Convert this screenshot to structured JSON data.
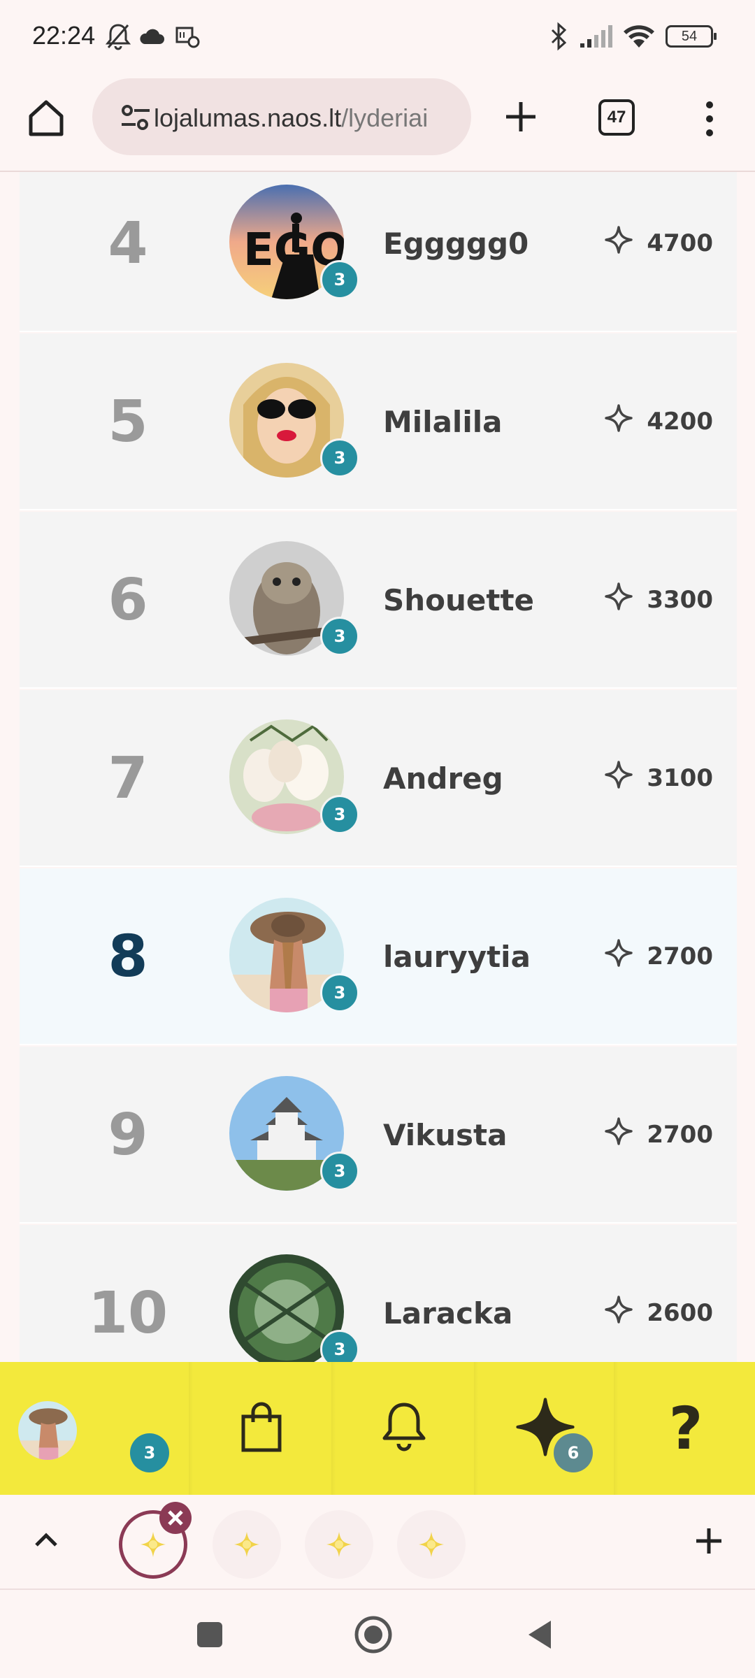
{
  "status_bar": {
    "time": "22:24",
    "battery": "54",
    "icons": [
      "bell-off-icon",
      "cloud-icon",
      "ticket-icon",
      "bluetooth-icon",
      "signal-icon",
      "wifi-icon",
      "battery-icon"
    ]
  },
  "browser": {
    "url_host": "lojalumas.naos.lt",
    "url_path": "/lyderiai",
    "tab_count": "47",
    "icons": [
      "home-icon",
      "site-settings-icon",
      "new-tab-plus-icon",
      "tab-switcher-icon",
      "more-menu-icon"
    ]
  },
  "leaderboard": {
    "rows": [
      {
        "rank": "4",
        "name": "Eggggg0",
        "level": "3",
        "points": "4700",
        "current_user": false
      },
      {
        "rank": "5",
        "name": "Milalila",
        "level": "3",
        "points": "4200",
        "current_user": false
      },
      {
        "rank": "6",
        "name": "Shouette",
        "level": "3",
        "points": "3300",
        "current_user": false
      },
      {
        "rank": "7",
        "name": "Andreg",
        "level": "3",
        "points": "3100",
        "current_user": false
      },
      {
        "rank": "8",
        "name": "lauryytia",
        "level": "3",
        "points": "2700",
        "current_user": true
      },
      {
        "rank": "9",
        "name": "Vikusta",
        "level": "3",
        "points": "2700",
        "current_user": false
      },
      {
        "rank": "10",
        "name": "Laracka",
        "level": "3",
        "points": "2600",
        "current_user": false
      }
    ]
  },
  "site_nav": {
    "profile_level": "3",
    "points_badge": "6",
    "help_label": "?",
    "icons": [
      "shopping-bag-icon",
      "bell-icon",
      "sparkle-star-icon"
    ]
  },
  "colors": {
    "accent_yellow": "#f3e93c",
    "badge_teal": "#268fa0",
    "current_rank": "#123c58",
    "tab_active": "#8b3a55"
  }
}
